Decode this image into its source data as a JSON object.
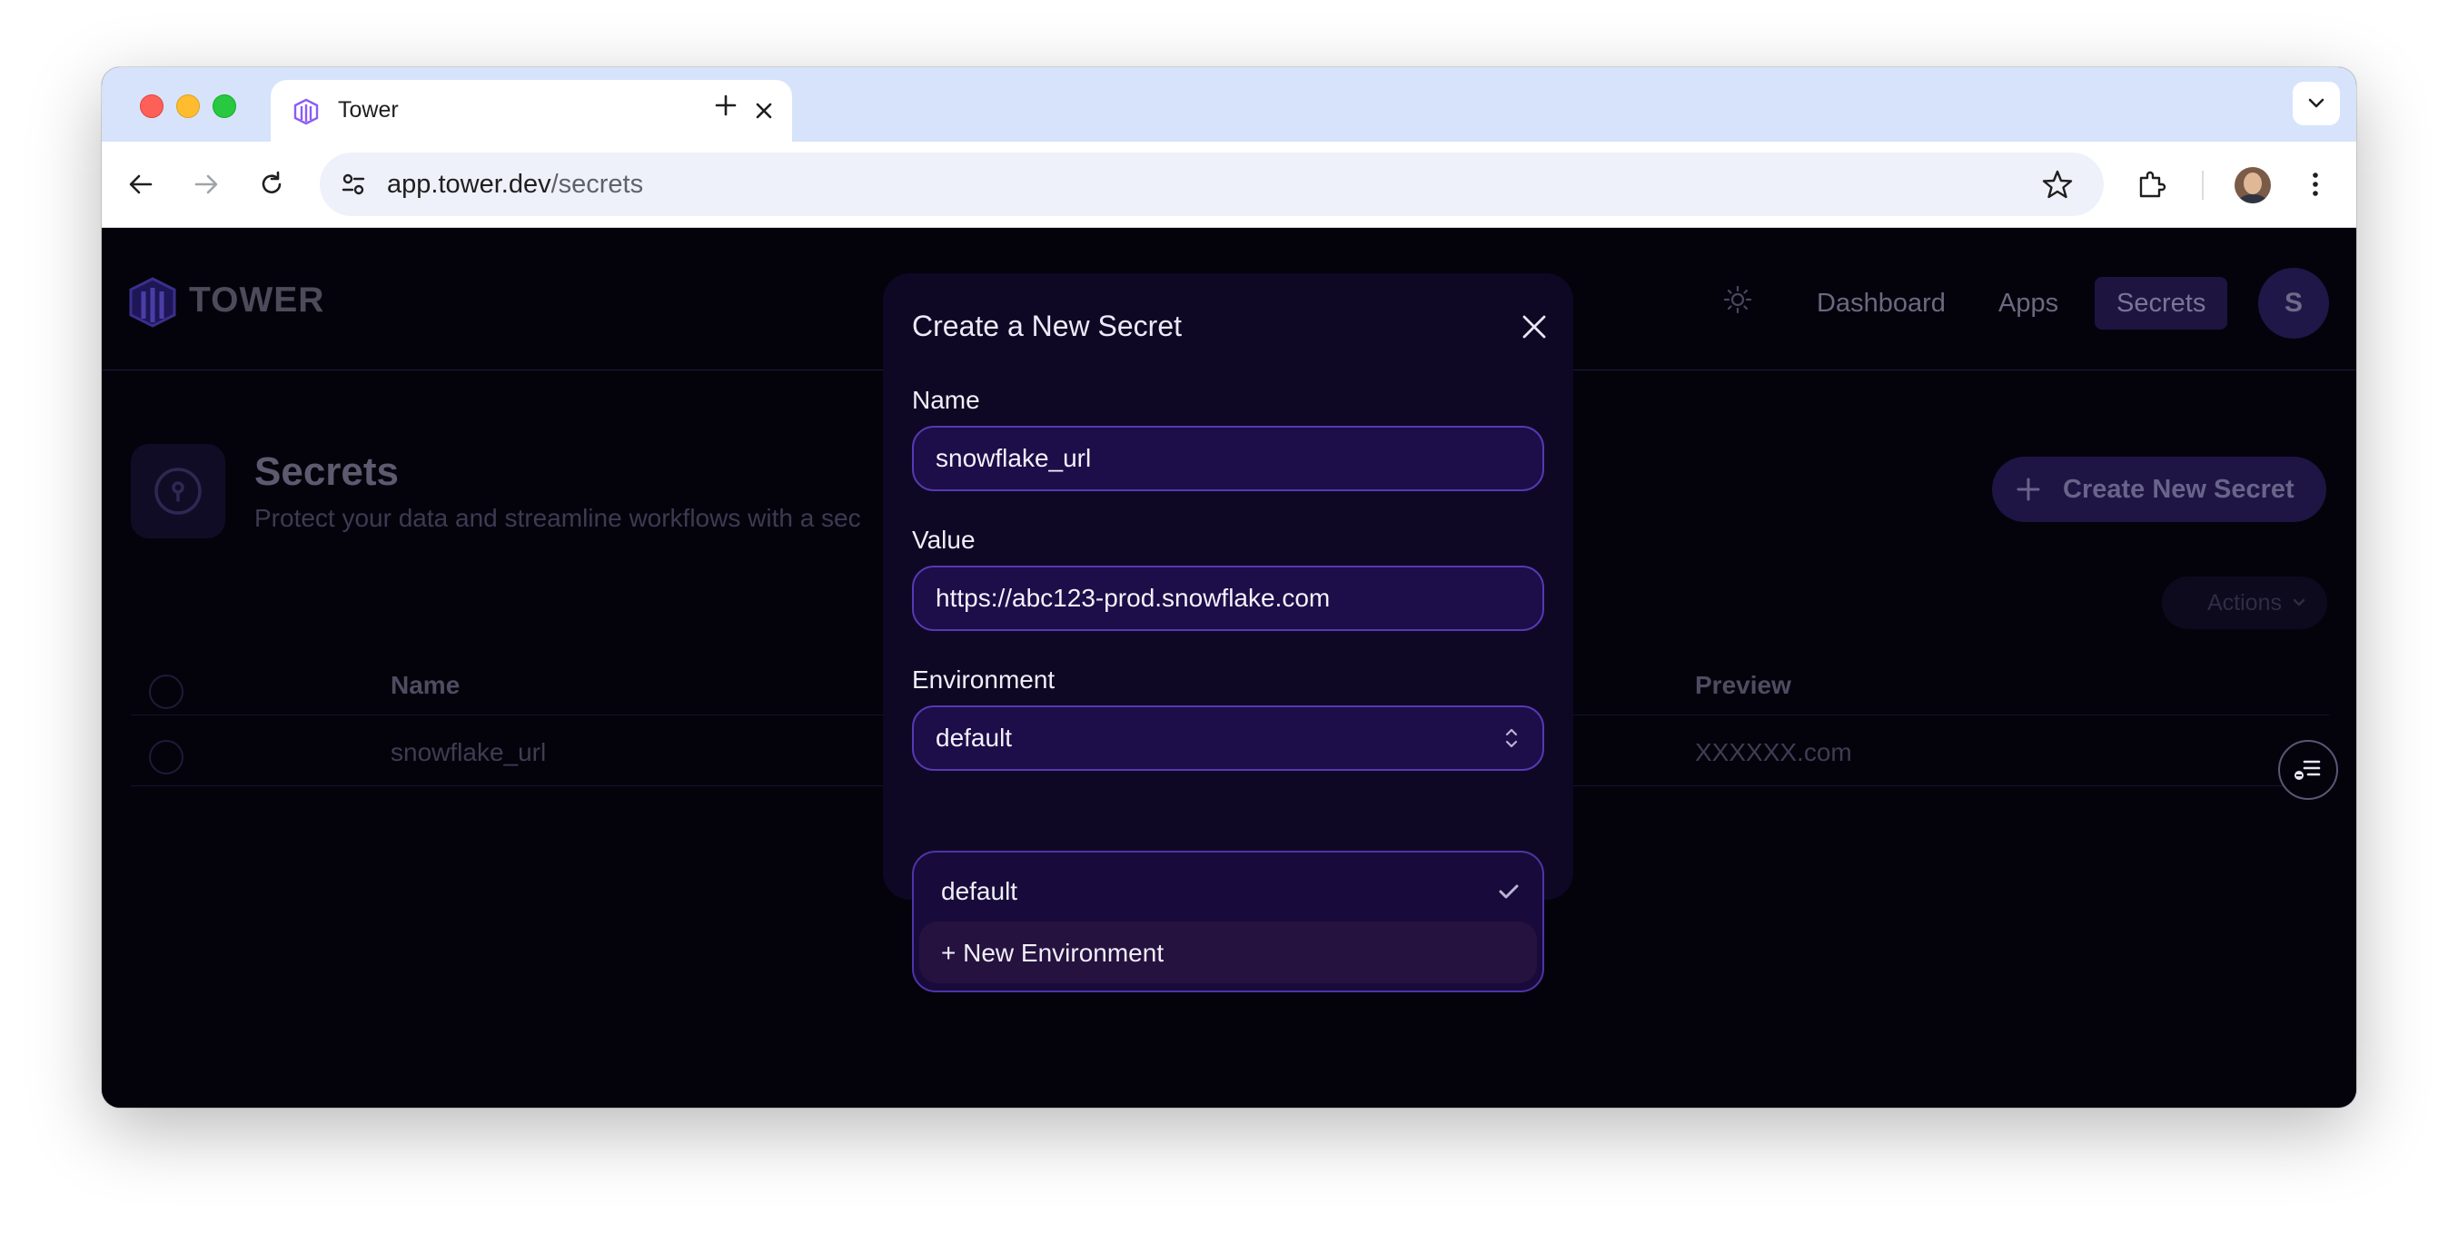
{
  "browser": {
    "tab_title": "Tower",
    "url_host": "app.tower.dev",
    "url_path": "/secrets"
  },
  "app": {
    "brand": "TOWER",
    "nav": [
      "Dashboard",
      "Apps",
      "Secrets"
    ],
    "active_nav": "Secrets",
    "user_initial": "S"
  },
  "page": {
    "title": "Secrets",
    "subtitle": "Protect your data and streamline workflows with a sec",
    "create_button": "Create New Secret",
    "actions_button": "Actions"
  },
  "table": {
    "columns": [
      "Name",
      "Preview"
    ],
    "rows": [
      {
        "name": "snowflake_url",
        "preview": "XXXXXX.com"
      }
    ]
  },
  "modal": {
    "title": "Create a New Secret",
    "name_label": "Name",
    "name_value": "snowflake_url",
    "value_label": "Value",
    "value_value": "https://abc123-prod.snowflake.com",
    "environment_label": "Environment",
    "environment_value": "default",
    "environment_options": [
      "default",
      "+ New Environment"
    ],
    "selected_option": "default"
  },
  "colors": {
    "page_bg": "#04030c",
    "modal_bg": "#0e0824",
    "input_bg": "#1d0d48",
    "input_border": "#5639b2",
    "accent": "#8b5cf6"
  }
}
